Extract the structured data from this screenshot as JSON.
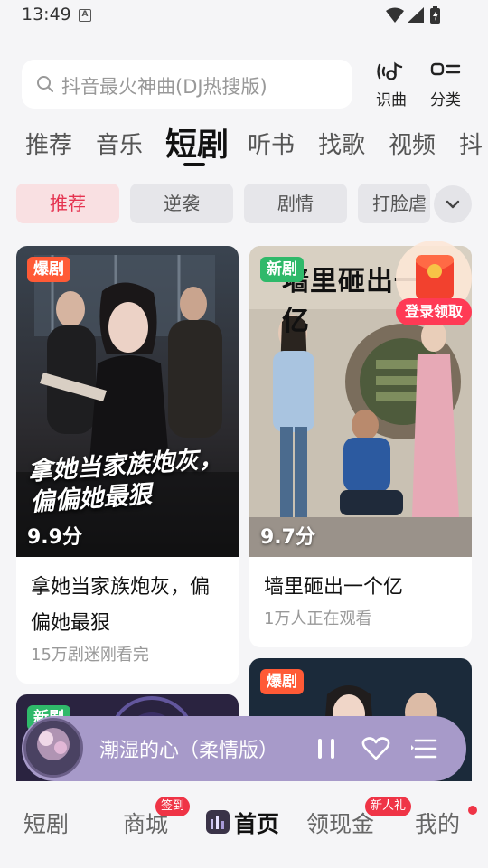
{
  "status": {
    "time": "13:49",
    "a_icon": "A"
  },
  "search": {
    "placeholder": "抖音最火神曲(DJ热搜版)"
  },
  "top_buttons": {
    "identify": "识曲",
    "category": "分类"
  },
  "category_tabs": [
    "推荐",
    "音乐",
    "短剧",
    "听书",
    "找歌",
    "视频",
    "抖"
  ],
  "active_category": "短剧",
  "sub_tabs": [
    "推荐",
    "逆袭",
    "剧情",
    "打脸虐"
  ],
  "active_sub_tab": "推荐",
  "cards": [
    {
      "badge": "爆剧",
      "score": "9.9分",
      "title": "拿她当家族炮灰，偏偏她最狠",
      "subtitle": "15万剧迷刚看完",
      "poster_text": "拿她当家族炮灰，偏偏她最狠"
    },
    {
      "badge": "新剧",
      "score": "9.7分",
      "title": "墙里砸出一个亿",
      "subtitle": "1万人正在观看",
      "poster_text": "墙里砸出一个亿"
    },
    {
      "badge": "新剧"
    },
    {
      "badge": "爆剧"
    }
  ],
  "promo": {
    "login_label": "登录领取"
  },
  "player": {
    "song": "潮湿的心（柔情版）"
  },
  "bottom_nav": {
    "items": [
      "短剧",
      "商城",
      "首页",
      "领现金",
      "我的"
    ],
    "active": "首页",
    "badge_mall": "签到",
    "badge_cash": "新人礼"
  },
  "colors": {
    "accent": "#e53350",
    "hot_badge": "#ff5a36",
    "new_badge": "#2fb96a",
    "player_bg": "#a79ac9"
  }
}
